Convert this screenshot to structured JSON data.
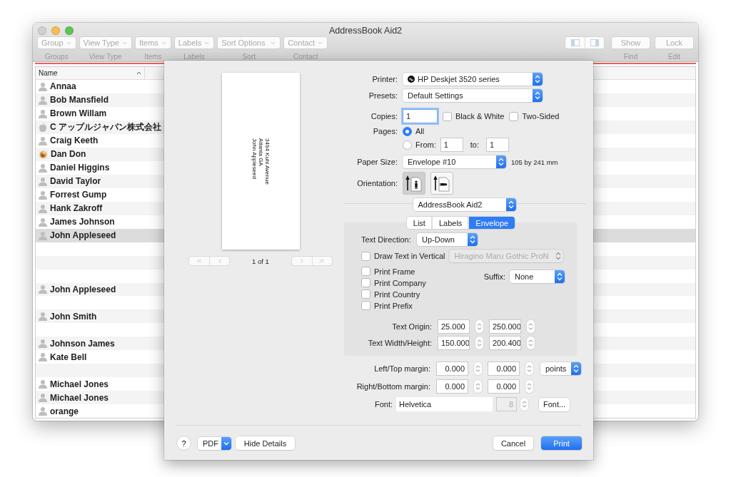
{
  "window": {
    "title": "AddressBook Aid2"
  },
  "toolbar": {
    "disabled": true,
    "groups": [
      {
        "control": "Group",
        "label": "Groups"
      },
      {
        "control": "View Type",
        "label": "View Type"
      },
      {
        "control": "Items",
        "label": "Items"
      },
      {
        "control": "Labels",
        "label": "Labels"
      },
      {
        "control": "Sort Options",
        "label": "Sort"
      },
      {
        "control": "Contact",
        "label": "Contact"
      }
    ],
    "actions": [
      {
        "control": "Show",
        "label": "Find"
      },
      {
        "control": "Lock",
        "label": "Edit"
      }
    ]
  },
  "contacts": {
    "column": "Name",
    "rows": [
      {
        "kind": "person",
        "name": "Annaa",
        "selected": false
      },
      {
        "kind": "person",
        "name": "Bob Mansfield",
        "selected": false
      },
      {
        "kind": "person",
        "name": "Brown Willam",
        "selected": false
      },
      {
        "kind": "apple",
        "name": "C アップルジャパン株式会社",
        "selected": false
      },
      {
        "kind": "person",
        "name": "Craig Keeth",
        "selected": false
      },
      {
        "name": "Dan Don",
        "selected": false
      },
      {
        "kind": "person",
        "name": "Daniel Higgins",
        "selected": false
      },
      {
        "kind": "person",
        "name": "David Taylor",
        "selected": false
      },
      {
        "kind": "person",
        "name": "Forrest Gump",
        "selected": false
      },
      {
        "kind": "person",
        "name": "Hank Zakroff",
        "selected": false
      },
      {
        "kind": "person",
        "name": "James Johnson",
        "selected": false
      },
      {
        "kind": "person",
        "name": "John Appleseed",
        "selected": true
      },
      {
        "kind": "blank"
      },
      {
        "kind": "blank"
      },
      {
        "kind": "blank"
      },
      {
        "kind": "person",
        "name": "John Appleseed",
        "selected": false
      },
      {
        "kind": "blank"
      },
      {
        "kind": "person",
        "name": "John Smith",
        "selected": false
      },
      {
        "kind": "blank"
      },
      {
        "kind": "person",
        "name": "Johnson James",
        "selected": false
      },
      {
        "kind": "person",
        "name": "Kate Bell",
        "selected": false
      },
      {
        "kind": "blank"
      },
      {
        "kind": "person",
        "name": "Michael Jones",
        "selected": false
      },
      {
        "kind": "person",
        "name": "Michael Jones",
        "selected": false
      },
      {
        "kind": "person",
        "name": "orange",
        "selected": false
      }
    ]
  },
  "print_dialog": {
    "preview": {
      "address_lines": [
        "3494 Kuhl Avenue",
        "Atlanta GA",
        "John Appleseed"
      ],
      "page_indicator": "1 of 1"
    },
    "printer": {
      "label": "Printer:",
      "value": "HP Deskjet 3520 series"
    },
    "presets": {
      "label": "Presets:",
      "value": "Default Settings"
    },
    "copies": {
      "label": "Copies:",
      "value": "1"
    },
    "checkboxes": [
      {
        "label": "Black & White",
        "checked": false
      },
      {
        "label": "Two-Sided",
        "checked": false
      }
    ],
    "pages": {
      "label": "Pages:",
      "options": [
        {
          "label": "All",
          "selected": true
        },
        {
          "label": "From:",
          "selected": false
        }
      ],
      "from": "1",
      "to_label": "to:",
      "to": "1"
    },
    "paper_size": {
      "label": "Paper Size:",
      "value": "Envelope #10",
      "dimensions": "105 by 241 mm"
    },
    "orientation": {
      "label": "Orientation:",
      "options": [
        {
          "kind": "portrait",
          "selected": true
        },
        {
          "kind": "landscape",
          "selected": false
        }
      ]
    },
    "plugin": "AddressBook Aid2",
    "tabs": [
      {
        "label": "List",
        "selected": false
      },
      {
        "label": "Labels",
        "selected": false
      },
      {
        "label": "Envelope",
        "selected": true
      }
    ],
    "envelope": {
      "text_direction": {
        "label": "Text Direction:",
        "value": "Up-Down"
      },
      "draw_vertical": {
        "label": "Draw Text in Vertical",
        "checked": false,
        "font": "Hiragino Maru Gothic ProN"
      },
      "options": [
        {
          "label": "Print Frame",
          "checked": false
        },
        {
          "label": "Print Company",
          "checked": false
        },
        {
          "label": "Print Country",
          "checked": false
        },
        {
          "label": "Print Prefix",
          "checked": false
        }
      ],
      "suffix": {
        "label": "Suffix:",
        "value": "None"
      },
      "text_origin": {
        "label": "Text Origin:",
        "values": [
          "25.000",
          "250.000"
        ]
      },
      "text_size": {
        "label": "Text Width/Height:",
        "values": [
          "150.000",
          "200.400"
        ]
      }
    },
    "left_top_margin": {
      "label": "Left/Top margin:",
      "values": [
        "0.000",
        "0.000"
      ],
      "unit": "points"
    },
    "right_bottom_margin": {
      "label": "Right/Bottom margin:",
      "values": [
        "0.000",
        "0.000"
      ]
    },
    "font": {
      "label": "Font:",
      "value": "Helvetica",
      "size": "8",
      "button": "Font..."
    },
    "help": "?",
    "pdf": "PDF",
    "hide_details": "Hide Details",
    "cancel": "Cancel",
    "print": "Print"
  }
}
